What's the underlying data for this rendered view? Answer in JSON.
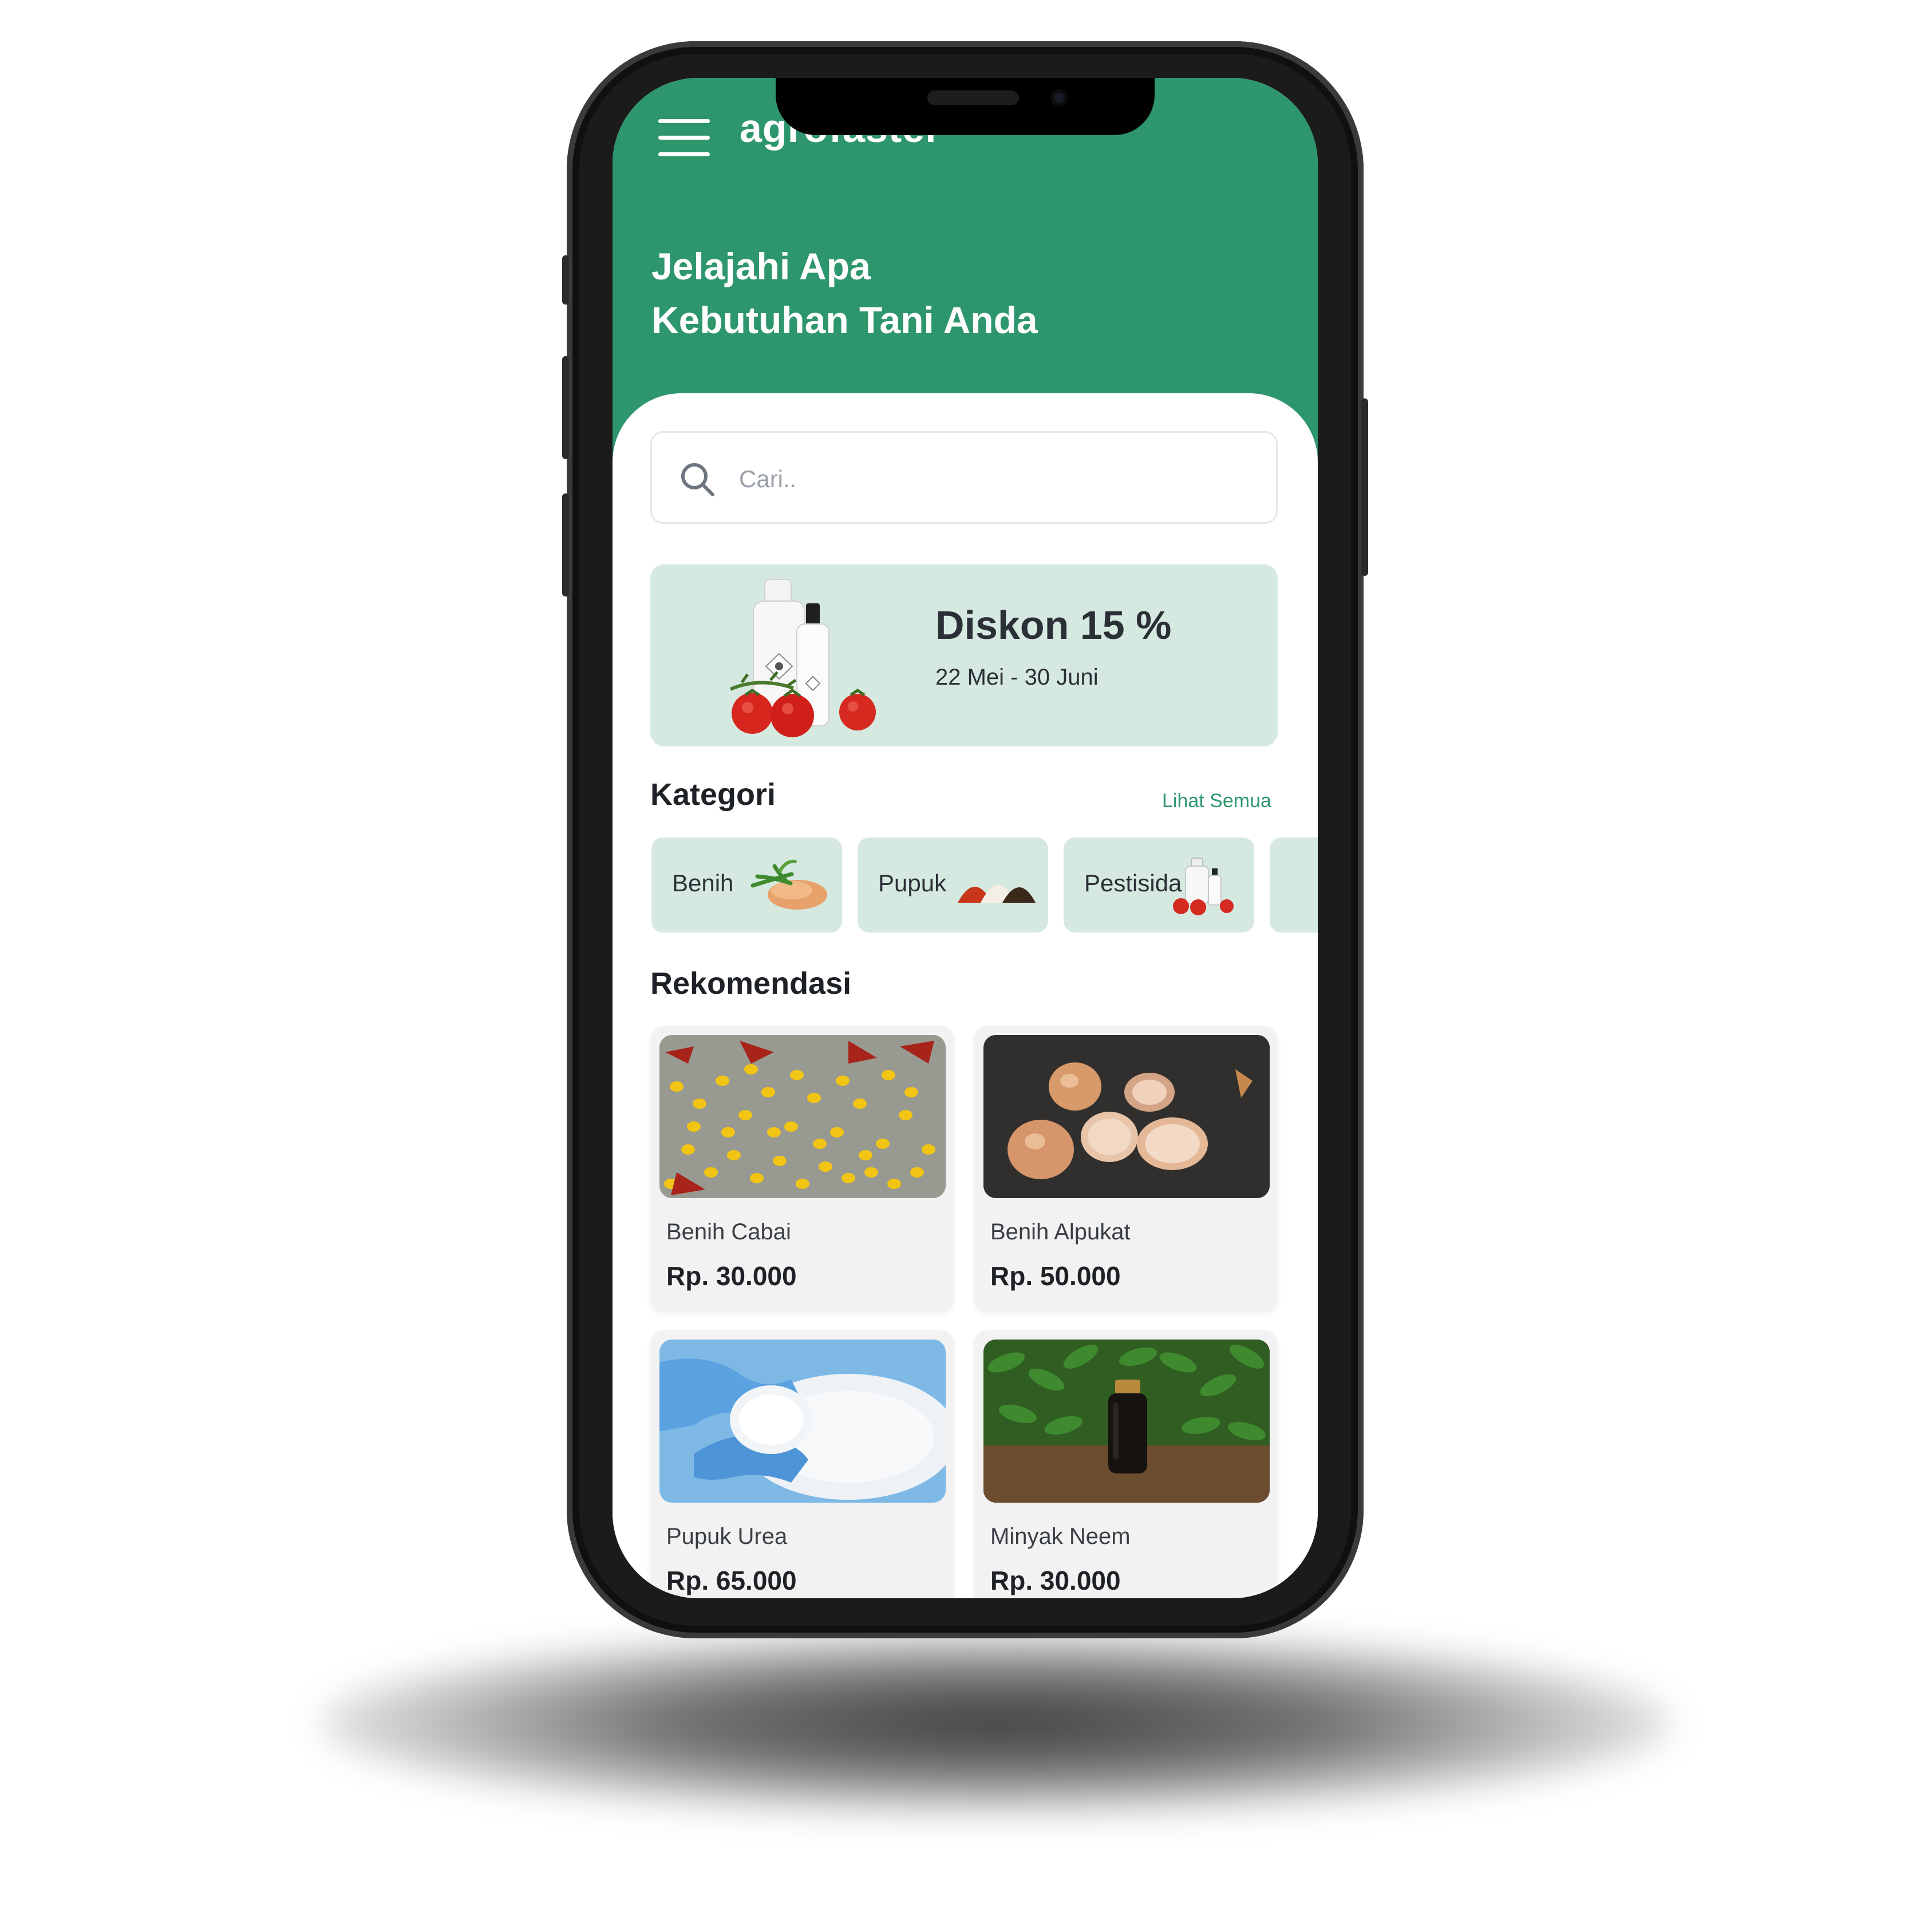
{
  "app": {
    "brand": "agrofaster"
  },
  "header": {
    "headline_line1": "Jelajahi Apa",
    "headline_line2": "Kebutuhan Tani Anda"
  },
  "search": {
    "placeholder": "Cari.."
  },
  "promo": {
    "title": "Diskon 15 %",
    "date_range": "22 Mei - 30 Juni"
  },
  "categories": {
    "title": "Kategori",
    "see_all_label": "Lihat Semua",
    "items": [
      {
        "label": "Benih"
      },
      {
        "label": "Pupuk"
      },
      {
        "label": "Pestisida"
      }
    ]
  },
  "recommendations": {
    "title": "Rekomendasi",
    "items": [
      {
        "name": "Benih Cabai",
        "price": "Rp. 30.000"
      },
      {
        "name": "Benih Alpukat",
        "price": "Rp. 50.000"
      },
      {
        "name": "Pupuk Urea",
        "price": "Rp. 65.000"
      },
      {
        "name": "Minyak Neem",
        "price": "Rp. 30.000"
      }
    ]
  },
  "icons": {
    "menu": "hamburger-menu-icon",
    "search": "search-icon"
  },
  "colors": {
    "primary_green": "#2e966d",
    "light_green": "#d6e9e1",
    "text_dark": "#1e2227"
  }
}
